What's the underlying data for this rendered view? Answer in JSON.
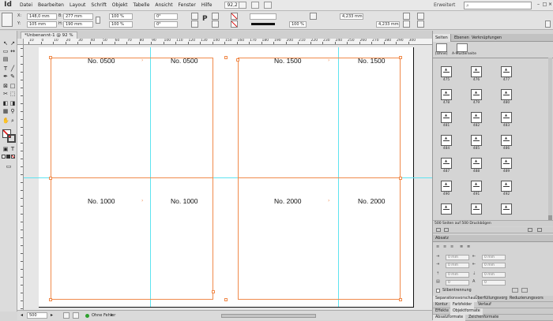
{
  "app": {
    "logo": "Id"
  },
  "menu": [
    "Datei",
    "Bearbeiten",
    "Layout",
    "Schrift",
    "Objekt",
    "Tabelle",
    "Ansicht",
    "Fenster",
    "Hilfe"
  ],
  "zoom": "92,2 %",
  "workspace": "Erweitert",
  "control": {
    "x": "148,0 mm",
    "y": "105 mm",
    "w": "277 mm",
    "h": "190 mm",
    "scale_x": "100 %",
    "scale_y": "100 %",
    "rotate": "0°",
    "shear": "0°",
    "stroke_pct": "100 %",
    "measure1": "4,233 mm",
    "measure2": "4,233 mm",
    "x_label": "X:",
    "y_label": "Y:",
    "w_label": "B:",
    "h_label": "H:",
    "p_label": "P"
  },
  "document": {
    "tab": "*Unbenannt-1 @ 92 %"
  },
  "ruler_top": [
    "10",
    "0",
    "10",
    "20",
    "30",
    "40",
    "50",
    "60",
    "70",
    "80",
    "90",
    "100",
    "110",
    "120",
    "130",
    "140",
    "150",
    "160",
    "170",
    "180",
    "190",
    "200",
    "210",
    "220",
    "230",
    "240",
    "250",
    "260",
    "270",
    "280",
    "290",
    "300"
  ],
  "page_labels": [
    "No. 0500",
    "No. 0500",
    "No. 1500",
    "No. 1500",
    "No. 1000",
    "No. 1000",
    "No. 2000",
    "No. 2000"
  ],
  "status": {
    "page": "500",
    "preflight": "Ohne Fehler"
  },
  "panels": {
    "tabs": [
      "Seiten",
      "Ebenen",
      "Verknüpfungen"
    ],
    "masters": [
      "[Ohne]",
      "A-Musterseite"
    ],
    "page_numbers": [
      "475",
      "476",
      "477",
      "478",
      "479",
      "480",
      "481",
      "482",
      "483",
      "484",
      "485",
      "486",
      "487",
      "488",
      "489",
      "490",
      "491",
      "492"
    ],
    "pages_footer": "500 Seiten auf 500 Druckbögen",
    "absatz": {
      "title": "Absatz",
      "fields": [
        "0 mm",
        "0 mm",
        "0 mm",
        "0 mm",
        "0 mm",
        "0 mm",
        "0",
        "0"
      ],
      "silbentrennung": "Silbentrennung"
    },
    "rows": [
      [
        "Separationsvorschau",
        "Überfüllungsvorg",
        "Reduzierungsvors"
      ],
      [
        "Kontur",
        "Farbfelder",
        "Verlauf"
      ],
      [
        "Effekte",
        "Objektformate"
      ],
      [
        "Absatzformate",
        "Zeichenformate"
      ]
    ]
  },
  "colors": {
    "frame": "#f08a4b",
    "guide": "#5ee3f0",
    "status_ok": "#2ea12e"
  }
}
